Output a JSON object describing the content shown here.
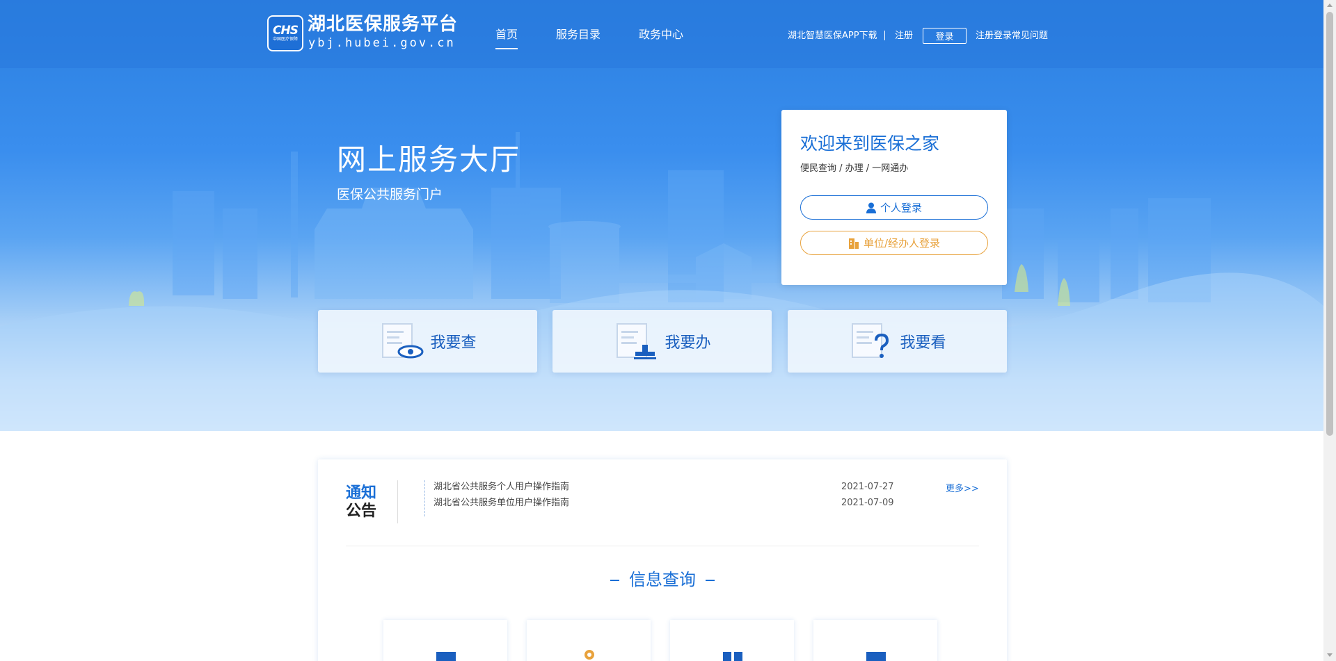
{
  "header": {
    "logo_text": "CHS",
    "logo_sub": "中国医疗保障",
    "site_title": "湖北医保服务平台",
    "site_url": "ybj.hubei.gov.cn",
    "nav": [
      {
        "label": "首页",
        "active": true
      },
      {
        "label": "服务目录",
        "active": false
      },
      {
        "label": "政务中心",
        "active": false
      }
    ],
    "app_download": "湖北智慧医保APP下载",
    "register": "注册",
    "login": "登录",
    "faq": "注册登录常见问题"
  },
  "hero": {
    "title": "网上服务大厅",
    "subtitle": "医保公共服务门户"
  },
  "login_card": {
    "welcome": "欢迎来到医保之家",
    "tagline": "便民查询 / 办理 / 一网通办",
    "personal_login": "个人登录",
    "unit_login": "单位/经办人登录",
    "colors": {
      "primary": "#1a6fd6",
      "accent": "#e8a23c"
    }
  },
  "quick": [
    {
      "label": "我要查",
      "icon": "document-eye-icon"
    },
    {
      "label": "我要办",
      "icon": "document-stamp-icon"
    },
    {
      "label": "我要看",
      "icon": "document-question-icon"
    }
  ],
  "notice": {
    "title_line1": "通知",
    "title_line2": "公告",
    "items": [
      {
        "text": "湖北省公共服务个人用户操作指南",
        "date": "2021-07-27"
      },
      {
        "text": "湖北省公共服务单位用户操作指南",
        "date": "2021-07-09"
      }
    ],
    "more": "更多>>"
  },
  "info_section": {
    "title": "信息查询"
  }
}
